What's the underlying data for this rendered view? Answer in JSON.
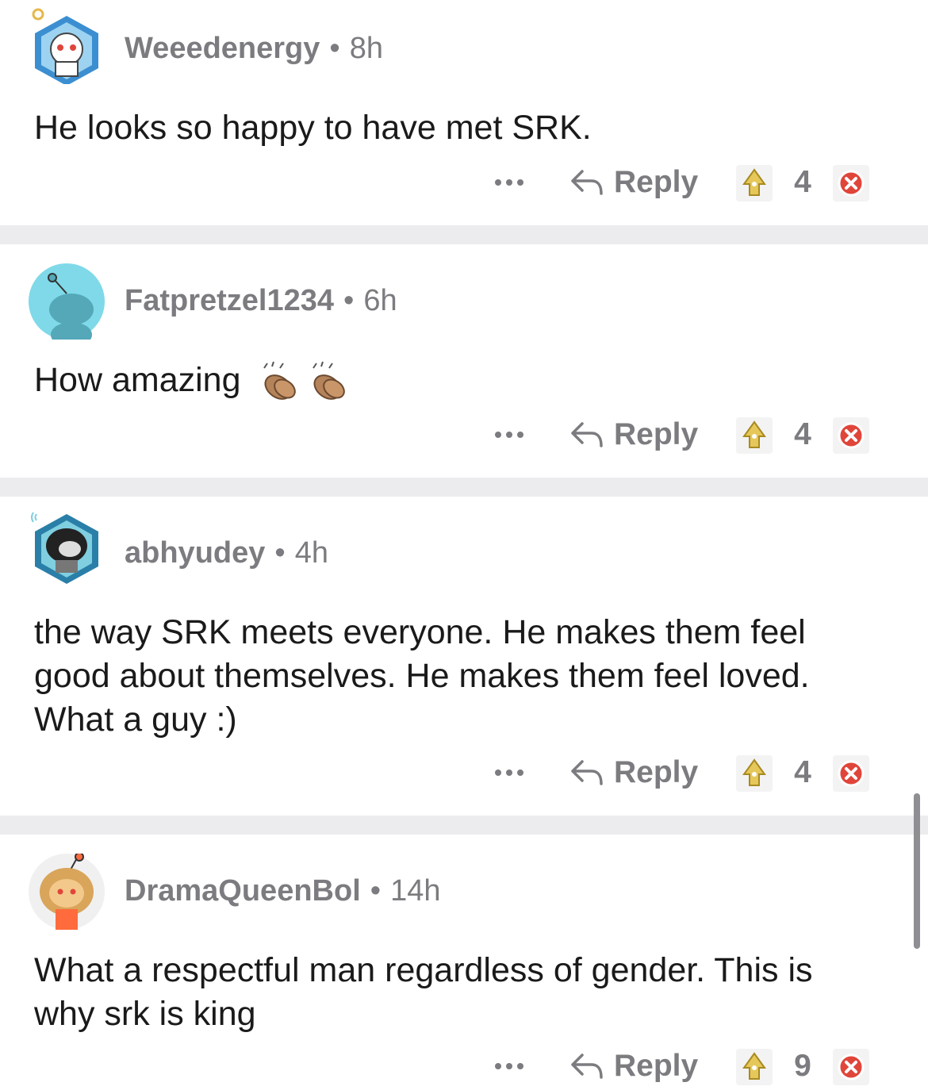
{
  "comments": [
    {
      "username": "Weeedenergy",
      "time": "8h",
      "text": "He looks so happy to have met SRK.",
      "more_icon": "more-dots-icon",
      "reply_label": "Reply",
      "score": "4"
    },
    {
      "username": "Fatpretzel1234",
      "time": "6h",
      "text": "How amazing",
      "emoji": "clapping-hands-emoji",
      "more_icon": "more-dots-icon",
      "reply_label": "Reply",
      "score": "4"
    },
    {
      "username": "abhyudey",
      "time": "4h",
      "text_lines": [
        "the way SRK meets everyone. He makes them feel",
        "good about themselves. He makes them feel loved.",
        "What a guy :)"
      ],
      "more_icon": "more-dots-icon",
      "reply_label": "Reply",
      "score": "4"
    },
    {
      "username": "DramaQueenBol",
      "time": "14h",
      "text_lines": [
        "What a respectful man regardless of gender. This is",
        "why srk is king"
      ],
      "more_icon": "more-dots-icon",
      "reply_label": "Reply",
      "score": "9"
    }
  ],
  "colors": {
    "meta_gray": "#7c7c80",
    "separator": "#ececee",
    "upvote_gold": "#e6c85a",
    "downvote_red": "#e0453a"
  }
}
